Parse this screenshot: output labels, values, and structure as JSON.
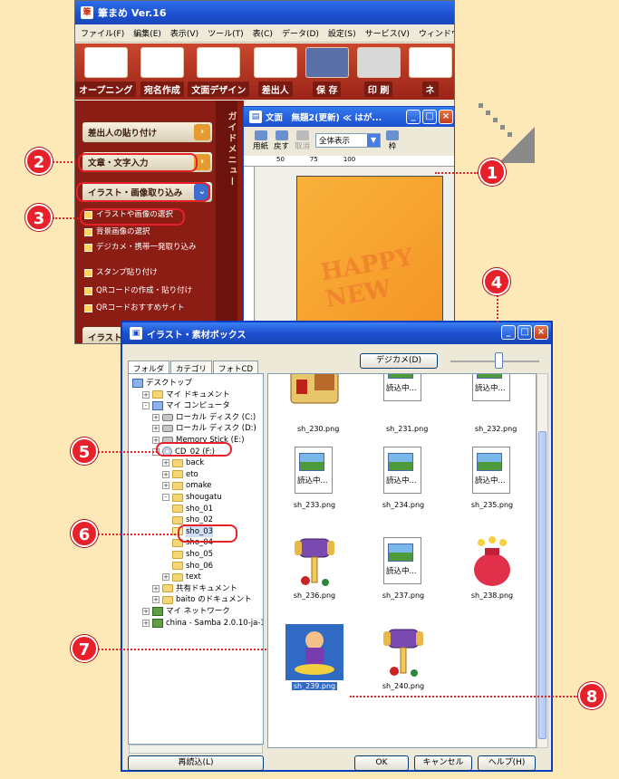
{
  "app": {
    "title": "筆まめ Ver.16",
    "logo": "筆",
    "menu": [
      "ファイル(F)",
      "編集(E)",
      "表示(V)",
      "ツール(T)",
      "表(C)",
      "データ(D)",
      "設定(S)",
      "サービス(V)",
      "ウィンドウ(W)"
    ],
    "toolbar": [
      "オープニング",
      "宛名作成",
      "文面デザイン",
      "差出人",
      "保 存",
      "印 刷",
      "ネ"
    ]
  },
  "guide_menu": {
    "side_label": "ガイドメニュー",
    "buttons": [
      "差出人の貼り付け",
      "文章・文字入力",
      "イラスト・画像取り込み",
      "イラスト"
    ],
    "sub_items": [
      "イラストや画像の選択",
      "背景画像の選択",
      "デジカメ・携帯一発取り込み",
      "スタンプ貼り付け",
      "QRコードの作成・貼り付け",
      "QRコードおすすめサイト"
    ]
  },
  "doc_window": {
    "title": "文面　無題2(更新) ≪ はが...",
    "tools": [
      "用紙",
      "戻す",
      "取消",
      "枠"
    ],
    "zoom": "全体表示",
    "ruler": [
      "50",
      "75",
      "100"
    ],
    "card_text": "HAPPY NEW"
  },
  "dialog": {
    "title": "イラスト・素材ボックス",
    "tabs": [
      "フォルダ",
      "カテゴリ",
      "フォトCD"
    ],
    "digicam_button": "デジカメ(D)",
    "slider_level": 0.55,
    "tree": [
      {
        "label": "デスクトップ",
        "icon": "desktop-icon",
        "indent": 0,
        "exp": ""
      },
      {
        "label": "マイ ドキュメント",
        "icon": "folder-icon",
        "indent": 1,
        "exp": "+"
      },
      {
        "label": "マイ コンピュータ",
        "icon": "computer-icon",
        "indent": 1,
        "exp": "-"
      },
      {
        "label": "ローカル ディスク (C:)",
        "icon": "drive-icon",
        "indent": 2,
        "exp": "+"
      },
      {
        "label": "ローカル ディスク (D:)",
        "icon": "drive-icon",
        "indent": 2,
        "exp": "+"
      },
      {
        "label": "Memory Stick (E:)",
        "icon": "drive-icon",
        "indent": 2,
        "exp": "+"
      },
      {
        "label": "CD_02 (F:)",
        "icon": "cd-icon",
        "indent": 2,
        "exp": "-"
      },
      {
        "label": "back",
        "icon": "folder-icon",
        "indent": 3,
        "exp": "+"
      },
      {
        "label": "eto",
        "icon": "folder-icon",
        "indent": 3,
        "exp": "+"
      },
      {
        "label": "omake",
        "icon": "folder-icon",
        "indent": 3,
        "exp": "+"
      },
      {
        "label": "shougatu",
        "icon": "folder-icon",
        "indent": 3,
        "exp": "-"
      },
      {
        "label": "sho_01",
        "icon": "folder-icon",
        "indent": 4,
        "exp": ""
      },
      {
        "label": "sho_02",
        "icon": "folder-icon",
        "indent": 4,
        "exp": ""
      },
      {
        "label": "sho_03",
        "icon": "folder-open-icon",
        "indent": 4,
        "exp": ""
      },
      {
        "label": "sho_04",
        "icon": "folder-icon",
        "indent": 4,
        "exp": ""
      },
      {
        "label": "sho_05",
        "icon": "folder-icon",
        "indent": 4,
        "exp": ""
      },
      {
        "label": "sho_06",
        "icon": "folder-icon",
        "indent": 4,
        "exp": ""
      },
      {
        "label": "text",
        "icon": "folder-icon",
        "indent": 3,
        "exp": "+"
      },
      {
        "label": "共有ドキュメント",
        "icon": "folder-icon",
        "indent": 2,
        "exp": "+"
      },
      {
        "label": "baito のドキュメント",
        "icon": "folder-icon",
        "indent": 2,
        "exp": "+"
      },
      {
        "label": "マイ ネットワーク",
        "icon": "network-icon",
        "indent": 1,
        "exp": "+"
      },
      {
        "label": "china - Samba 2.0.10-ja-1",
        "icon": "network-icon",
        "indent": 1,
        "exp": "+"
      }
    ],
    "files": [
      {
        "name": "",
        "kind": "dog"
      },
      {
        "name": "",
        "kind": "loading"
      },
      {
        "name": "",
        "kind": "loading"
      },
      {
        "name": "sh_230.png",
        "kind": "label"
      },
      {
        "name": "sh_231.png",
        "kind": "label"
      },
      {
        "name": "sh_232.png",
        "kind": "label"
      },
      {
        "name": "sh_233.png",
        "kind": "loading"
      },
      {
        "name": "sh_234.png",
        "kind": "loading"
      },
      {
        "name": "sh_235.png",
        "kind": "loading"
      },
      {
        "name": "sh_236.png",
        "kind": "mallet"
      },
      {
        "name": "sh_237.png",
        "kind": "loading"
      },
      {
        "name": "sh_238.png",
        "kind": "bag"
      },
      {
        "name": "sh_239.png",
        "kind": "figure"
      },
      {
        "name": "sh_240.png",
        "kind": "mallet"
      }
    ],
    "loading_text": "読込中...",
    "reload_button": "再読込(L)",
    "ok_button": "OK",
    "cancel_button": "キャンセル",
    "help_button": "ヘルプ(H)"
  },
  "callouts": [
    "1",
    "2",
    "3",
    "4",
    "5",
    "6",
    "7",
    "8"
  ],
  "colors": {
    "accent": "#e8202a",
    "guide_bg": "#8c1d14",
    "selection": "#316ac5"
  }
}
